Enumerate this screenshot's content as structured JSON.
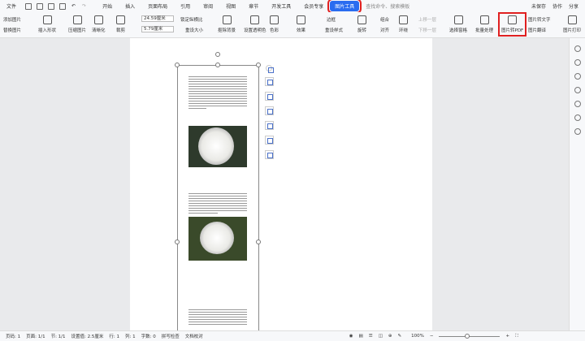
{
  "menu": {
    "file": "文件",
    "tabs": [
      "开始",
      "插入",
      "页面布局",
      "引用",
      "审阅",
      "视图",
      "章节",
      "开发工具",
      "会员专享",
      "图片工具"
    ],
    "search": "查找命令、搜索模板",
    "unsaved": "未保存",
    "collab": "协作",
    "share": "分享"
  },
  "ribbon": {
    "add_image": "添加图片",
    "replace_image": "替换图片",
    "insert_shape": "插入形状",
    "compress": "压缩图片",
    "sharpen": "清晰化",
    "crop": "裁剪",
    "width": "24.59厘米",
    "height": "5.79厘米",
    "lock_ratio": "锁定纵横比",
    "reset_size": "重设大小",
    "remove_bg": "抠除背景",
    "set_transparent": "设置透明色",
    "color": "色彩",
    "effects": "效果",
    "border": "边框",
    "reset_style": "重设样式",
    "rotate": "旋转",
    "group": "组合",
    "align": "对齐",
    "wrap": "环绕",
    "bring_forward": "上移一层",
    "send_backward": "下移一层",
    "selection_pane": "选择窗格",
    "batch": "批量处理",
    "to_pdf": "图片转PDF",
    "to_text": "图片转文字",
    "translate": "图片翻译",
    "print": "图片打印"
  },
  "status": {
    "page": "页码: 1",
    "pages": "页面: 1/1",
    "section": "节: 1/1",
    "setting": "设置值: 2.5厘米",
    "row": "行: 1",
    "col": "列: 1",
    "words": "字数: 0",
    "spell": "拼写检查",
    "proof": "文档校对",
    "zoom": "100%"
  },
  "colors": {
    "accent": "#2a6cf0",
    "highlight": "#e02020"
  }
}
